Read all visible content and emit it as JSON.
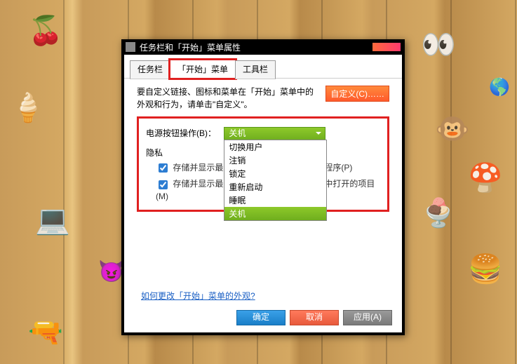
{
  "window": {
    "title": "任务栏和「开始」菜单属性"
  },
  "tabs": {
    "taskbar": "任务栏",
    "start": "「开始」菜单",
    "toolbars": "工具栏"
  },
  "desc": "要自定义链接、图标和菜单在「开始」菜单中的外观和行为，请单击\"自定义\"。",
  "customize": "自定义(C)……",
  "power": {
    "label": "电源按钮操作(B)：",
    "selected": "关机",
    "options": {
      "switch_user": "切换用户",
      "logoff": "注销",
      "lock": "锁定",
      "restart": "重新启动",
      "sleep": "睡眠",
      "shutdown": "关机"
    }
  },
  "privacy": {
    "label": "隐私",
    "opt1": "存储并显示最近在「开始」菜单中打开的程序(P)",
    "opt2": "存储并显示最近在「开始」菜单和任务栏中打开的项目(M)"
  },
  "link": "如何更改「开始」菜单的外观?",
  "buttons": {
    "ok": "确定",
    "cancel": "取消",
    "apply": "应用(A)"
  }
}
